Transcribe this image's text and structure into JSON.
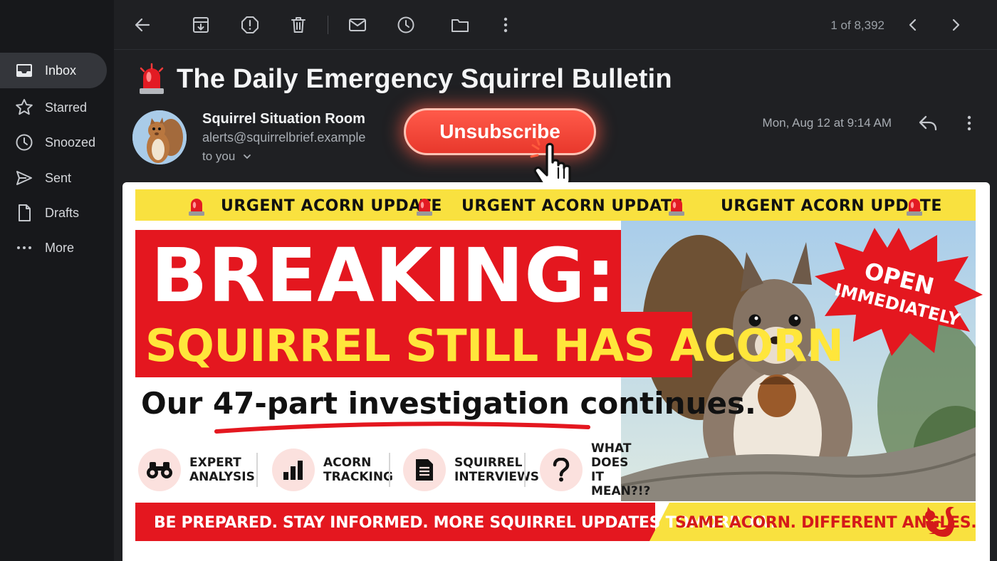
{
  "sidebar": {
    "items": [
      {
        "label": "Inbox",
        "icon": "inbox-icon",
        "active": true
      },
      {
        "label": "Starred",
        "icon": "star-icon"
      },
      {
        "label": "Snoozed",
        "icon": "clock-icon"
      },
      {
        "label": "Sent",
        "icon": "send-icon"
      },
      {
        "label": "Drafts",
        "icon": "draft-icon"
      },
      {
        "label": "More",
        "icon": "more-horiz-icon"
      }
    ]
  },
  "toolbar": {
    "icons": [
      "back-arrow-icon",
      "archive-icon",
      "report-spam-icon",
      "delete-icon",
      "mark-unread-icon",
      "snooze-icon",
      "move-to-folder-icon",
      "more-vert-icon"
    ],
    "pager_text": "1 of 8,392"
  },
  "message": {
    "subject": "The Daily Emergency Squirrel Bulletin",
    "sender_name": "Squirrel Situation Room",
    "sender_email": "alerts@squirrelbrief.example",
    "recipient": "to you",
    "unsubscribe_label": "Unsubscribe",
    "date": "Mon, Aug 12 at 9:14 AM"
  },
  "bulletin": {
    "ticker": [
      "URGENT ACORN UPDATE",
      "URGENT ACORN UPDATE",
      "URGENT ACORN UPDATE"
    ],
    "headline": "BREAKING:",
    "subheadline": "SQUIRREL STILL HAS ACORN",
    "tagline": "Our 47-part investigation continues.",
    "badge_line1": "OPEN",
    "badge_line2": "IMMEDIATELY",
    "features": [
      {
        "line1": "EXPERT",
        "line2": "ANALYSIS",
        "icon": "binoculars-icon"
      },
      {
        "line1": "ACORN",
        "line2": "TRACKING",
        "icon": "bar-chart-icon"
      },
      {
        "line1": "SQUIRREL",
        "line2": "INTERVIEWS",
        "icon": "document-icon"
      },
      {
        "line1": "WHAT DOES",
        "line2": "IT MEAN?!?",
        "icon": "question-icon"
      }
    ],
    "footer_left": "BE PREPARED. STAY INFORMED. MORE SQUIRREL UPDATES TOMORROW.",
    "footer_right": "SAME ACORN. DIFFERENT ANGLES."
  },
  "colors": {
    "accent_red": "#e4171f",
    "accent_yellow": "#f9e13f",
    "unsubscribe": "#ff4a3a",
    "background": "#1f2023"
  }
}
